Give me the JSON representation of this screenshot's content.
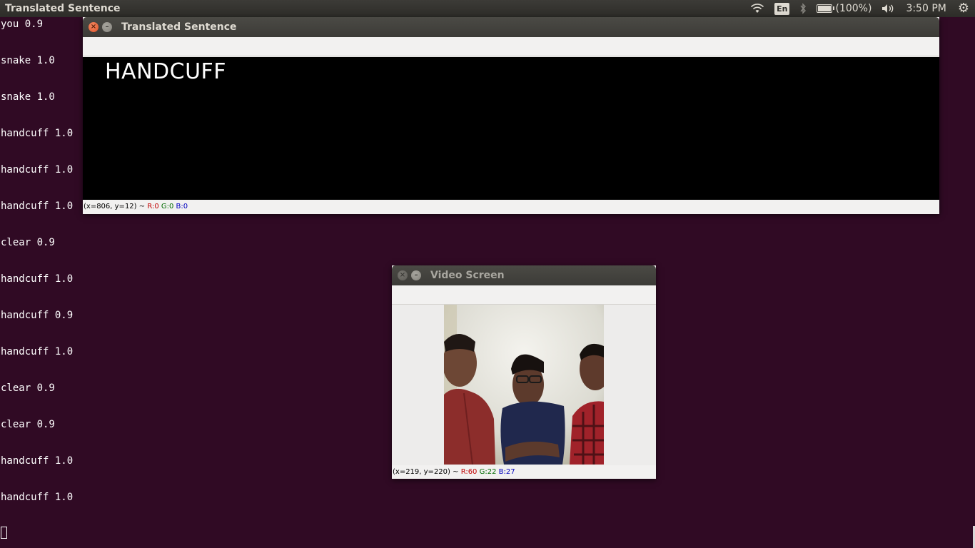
{
  "top_panel": {
    "app_title": "Translated Sentence",
    "lang": "En",
    "battery": "(100%)",
    "battery_level": 1.0,
    "clock": "3:50 PM",
    "icons": [
      "wifi-icon",
      "bluetooth-icon",
      "battery-icon",
      "volume-icon",
      "power-gear-icon"
    ]
  },
  "terminal": {
    "lines": [
      "you 0.9",
      "snake 1.0",
      "snake 1.0",
      "handcuff 1.0",
      "handcuff 1.0",
      "handcuff 1.0",
      "clear 0.9",
      "handcuff 1.0",
      "handcuff 0.9",
      "handcuff 1.0",
      "clear 0.9",
      "clear 0.9",
      "handcuff 1.0",
      "handcuff 1.0"
    ]
  },
  "window_sentence": {
    "title": "Translated Sentence",
    "sentence": "HANDCUFF",
    "status": {
      "coords": "(x=806, y=12) ~",
      "r": "R:0",
      "g": "G:0",
      "b": "B:0"
    }
  },
  "window_video": {
    "title": "Video Screen",
    "status": {
      "coords": "(x=219, y=220) ~",
      "r": "R:60",
      "g": "G:22",
      "b": "B:27"
    }
  },
  "colors": {
    "desktop_bg": "#300a24",
    "panel_bg": "#3c3b37",
    "close_button": "#e0542a"
  }
}
